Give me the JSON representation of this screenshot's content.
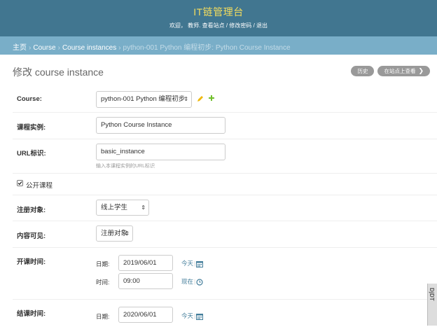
{
  "header": {
    "site_title": "IT链管理台",
    "welcome": "欢迎，",
    "username": "教师.",
    "view_site": "查看站点",
    "change_password": "修改密码",
    "logout": "退出",
    "separator": "/"
  },
  "breadcrumbs": {
    "items": [
      "主页",
      "Course",
      "Course instances",
      "python-001 Python 编程初步: Python Course Instance"
    ],
    "separator": "›"
  },
  "page": {
    "title": "修改 course instance",
    "history_button": "历史",
    "view_on_site_button": "在站点上查看"
  },
  "form": {
    "course": {
      "label": "Course:",
      "value": "python-001 Python 编程初步"
    },
    "instance_name": {
      "label": "课程实例:",
      "value": "Python Course Instance"
    },
    "url_slug": {
      "label": "URL标识:",
      "value": "basic_instance",
      "help": "输入本课程实例的URL标识"
    },
    "public": {
      "label": "公开课程",
      "checked": true
    },
    "enrollment_audience": {
      "label": "注册对象:",
      "value": "线上学生"
    },
    "content_visibility": {
      "label": "内容可见:",
      "value": "注册对象"
    },
    "starting_time": {
      "label": "开课时间:",
      "date_label": "日期:",
      "date_value": "2019/06/01",
      "today_link": "今天",
      "time_label": "时间:",
      "time_value": "09:00",
      "now_link": "现在"
    },
    "ending_time": {
      "label": "结课时间:",
      "date_label": "日期:",
      "date_value": "2020/06/01",
      "today_link": "今天"
    }
  },
  "edge_tab": {
    "label": "DjDT"
  },
  "colors": {
    "header_bg": "#417690",
    "title_yellow": "#f5dd5d",
    "breadcrumb_bg": "#79aec8",
    "link_blue": "#447e9b",
    "button_grey": "#999999"
  }
}
